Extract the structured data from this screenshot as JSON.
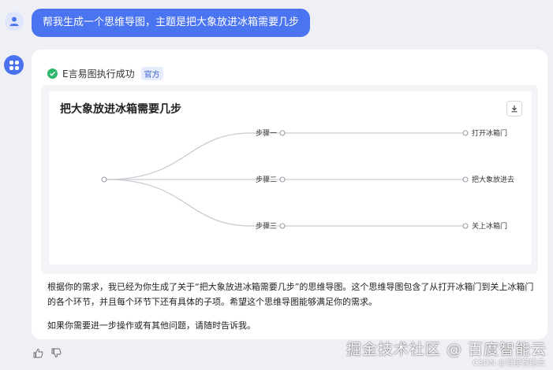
{
  "user_message": {
    "text": "帮我生成一个思维导图，主题是把大象放进冰箱需要几步"
  },
  "reply": {
    "plugin_status": "E言易图执行成功",
    "official_badge": "官方",
    "mindmap": {
      "title": "把大象放进冰箱需要几步",
      "branches": [
        {
          "step": "步骤一",
          "action": "打开冰箱门"
        },
        {
          "step": "步骤二",
          "action": "把大象放进去"
        },
        {
          "step": "步骤三",
          "action": "关上冰箱门"
        }
      ]
    },
    "paragraph_1": "根据你的需求，我已经为你生成了关于“把大象放进冰箱需要几步”的思维导图。这个思维导图包含了从打开冰箱门到关上冰箱门的各个环节，并且每个环节下还有具体的子项。希望这个思维导图能够满足你的需求。",
    "paragraph_2": "如果你需要进一步操作或有其他问题，请随时告诉我。"
  },
  "watermark": {
    "main": "掘金技术社区 @ 百度智能云",
    "sub": "CSDN @百度智能云"
  },
  "colors": {
    "accent": "#4b74f0",
    "success": "#2fb76c",
    "background": "#eef0f6"
  },
  "icons": {
    "user_avatar": "person-icon",
    "bot_avatar": "grid-icon",
    "status": "check-circle-icon",
    "download": "download-icon",
    "like": "thumbs-up-icon",
    "dislike": "thumbs-down-icon"
  }
}
